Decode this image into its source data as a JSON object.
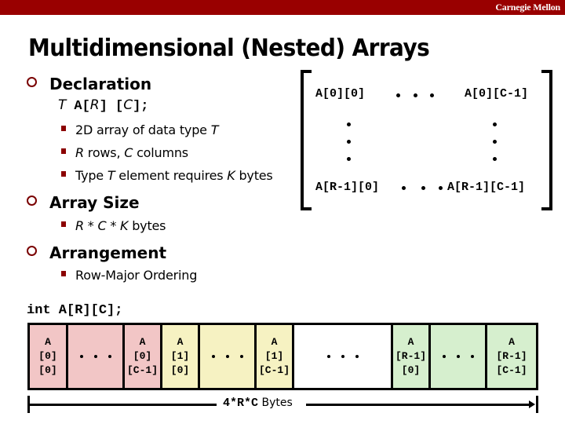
{
  "header": {
    "brand": "Carnegie Mellon",
    "bar_color": "#990000"
  },
  "title": "Multidimensional (Nested) Arrays",
  "bullets": {
    "declaration": {
      "heading": "Declaration",
      "code": {
        "type": "T",
        "name": "A",
        "r": "R",
        "c": "C"
      },
      "items": [
        {
          "pre": "2D array of data type ",
          "it": "T",
          "post": ""
        },
        {
          "pre": "",
          "it": "R",
          "post": " rows, ",
          "it2": "C",
          "post2": " columns"
        },
        {
          "pre": "Type ",
          "it": "T",
          "post": " element requires ",
          "it2": "K",
          "post2": " bytes"
        }
      ]
    },
    "array_size": {
      "heading": "Array Size",
      "formula": "R * C * K",
      "unit": " bytes"
    },
    "arrangement": {
      "heading": "Arrangement",
      "item": "Row-Major Ordering"
    }
  },
  "matrix": {
    "top_left": "A[0][0]",
    "top_right": "A[0][C-1]",
    "bottom_left": "A[R-1][0]",
    "bottom_right": "A[R-1][C-1]"
  },
  "code_decl": "int A[R][C];",
  "memory": {
    "cells": [
      {
        "color": "pink",
        "lines": [
          "A",
          "[0]",
          "[0]"
        ]
      },
      {
        "color": "pink",
        "ellipsis": true
      },
      {
        "color": "pink",
        "lines": [
          "A",
          "[0]",
          "[C-1]"
        ]
      },
      {
        "color": "yellow",
        "lines": [
          "A",
          "[1]",
          "[0]"
        ]
      },
      {
        "color": "yellow",
        "ellipsis": true
      },
      {
        "color": "yellow",
        "lines": [
          "A",
          "[1]",
          "[C-1]"
        ]
      },
      {
        "color": "white",
        "ellipsis": true
      },
      {
        "color": "green",
        "lines": [
          "A",
          "[R-1]",
          "[0]"
        ]
      },
      {
        "color": "green",
        "ellipsis": true
      },
      {
        "color": "green",
        "lines": [
          "A",
          "[R-1]",
          "[C-1]"
        ]
      }
    ],
    "colors": {
      "pink": "#f2c6c6",
      "yellow": "#f6f2c2",
      "green": "#d6efce",
      "white": "#ffffff"
    },
    "size_label_code": "4*R*C",
    "size_label_unit": "Bytes"
  }
}
